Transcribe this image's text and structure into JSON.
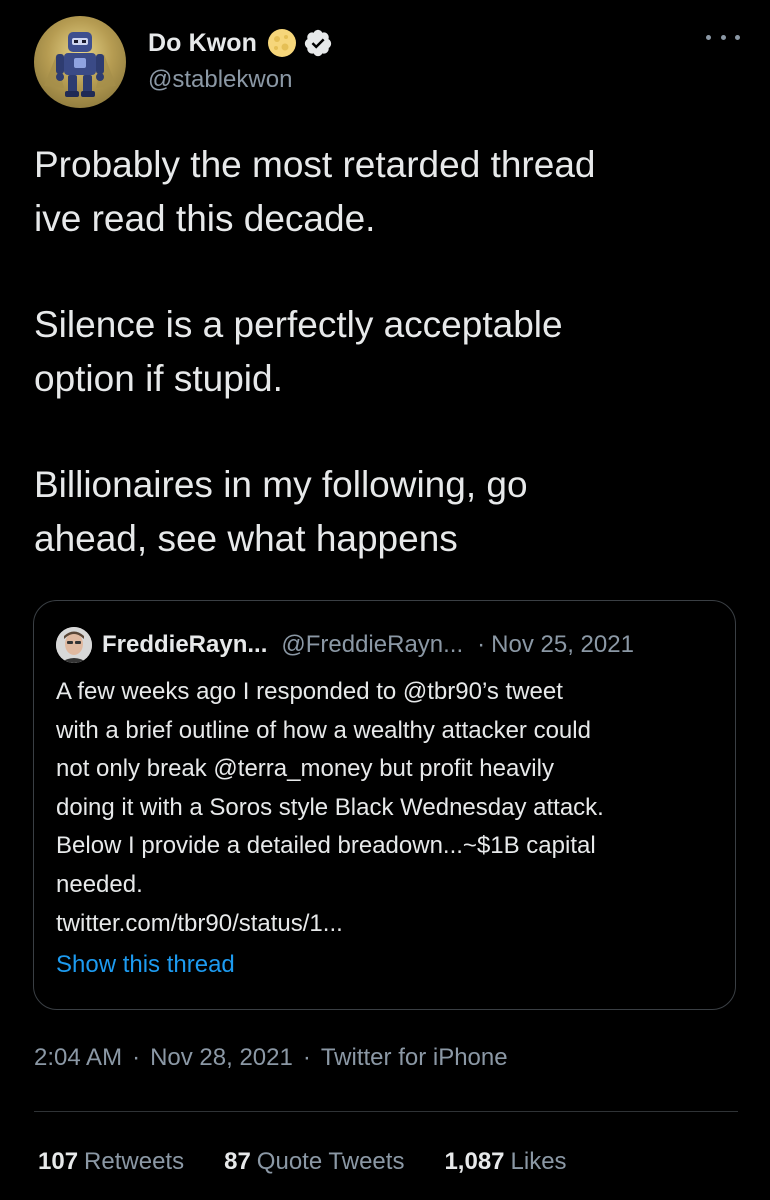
{
  "author": {
    "display_name": "Do Kwon",
    "handle": "@stablekwon",
    "name_emoji": "moon-emoji",
    "badge": "verified-badge-icon",
    "avatar": "avatar-robot-image"
  },
  "tweet": {
    "paragraphs": [
      "Probably the most retarded thread\nive read this decade.",
      "Silence is a perfectly acceptable\noption if stupid.",
      "Billionaires in my following, go\nahead, see what happens"
    ]
  },
  "quote": {
    "name": "FreddieRayn...",
    "handle": "@FreddieRayn...",
    "separator": "·",
    "date": "Nov 25, 2021",
    "lines": [
      "A few weeks ago I responded to @tbr90’s tweet",
      "with a brief outline of how a wealthy attacker could",
      "not only break @terra_money but profit heavily",
      "doing it with a Soros style Black Wednesday attack.",
      "Below I provide a detailed breadown...~$1B capital",
      "needed.",
      "twitter.com/tbr90/status/1..."
    ],
    "show_thread": "Show this thread"
  },
  "meta": {
    "time": "2:04 AM",
    "sep1": "·",
    "date": "Nov 28, 2021",
    "sep2": "·",
    "app": "Twitter for iPhone"
  },
  "stats": {
    "retweets_count": "107",
    "retweets_label": "Retweets",
    "quotes_count": "87",
    "quotes_label": "Quote Tweets",
    "likes_count": "1,087",
    "likes_label": "Likes"
  },
  "colors": {
    "background": "#000000",
    "text": "#e7e9ea",
    "secondary": "#8b98a5",
    "link": "#1d9bf0",
    "border": "#3a3f44"
  }
}
